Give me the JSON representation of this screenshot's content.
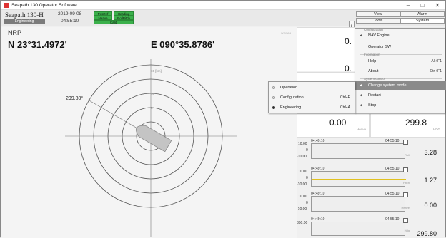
{
  "app": {
    "window_title": "Seapath 130 Operator Software",
    "product_name": "Seapath 130-H",
    "mode": "Engineering",
    "date": "2019-09-08",
    "time": "04:55:10"
  },
  "status_flags": [
    "PosRef",
    "Heading",
    "Heave",
    "RollPitch",
    "Calib"
  ],
  "top_buttons": {
    "view": "View",
    "alarm": "Alarm",
    "tools": "Tools",
    "system": "System"
  },
  "main": {
    "title": "NRP",
    "latitude": "N 23°31.4972'",
    "longitude": "E 090°35.8786'",
    "heading_mark": "299.80°",
    "ring_labels": [
      "15 [km]",
      "10",
      "5"
    ],
    "sensor_code": "WGS84"
  },
  "tiles": {
    "row1_value": "0.",
    "row2_value": "0.",
    "heave_value": "0.00",
    "heave_unit": "Heave",
    "hdg_value": "299.8",
    "hdg_unit": "HDG"
  },
  "menu": {
    "section_configuration": "Configuration",
    "nav_engine": "NAV Engine",
    "operator_sw": "Operator SW",
    "section_information": "Information",
    "help": "Help",
    "help_shortcut": "Alt+F1",
    "about": "About",
    "about_shortcut": "Ctrl+F1",
    "section_system_control": "System control",
    "change_system_mode": "Change system mode",
    "restart": "Restart",
    "stop": "Stop"
  },
  "submenu": {
    "operation": "Operation",
    "configuration": "Configuration",
    "configuration_shortcut": "Ctrl+E",
    "engineering": "Engineering",
    "engineering_shortcut": "Ctrl+A"
  },
  "trends": [
    {
      "start": "04:49:10",
      "end": "04:55:10",
      "ymax": "10.00",
      "ymid": "0",
      "ymin": "-10.00",
      "value": "3.28",
      "unit": "Roll",
      "color": "#3bb04b"
    },
    {
      "start": "04:49:10",
      "end": "04:55:10",
      "ymax": "10.00",
      "ymid": "0",
      "ymin": "-10.00",
      "value": "1.27",
      "unit": "Pitch",
      "color": "#e0c020"
    },
    {
      "start": "04:49:10",
      "end": "04:55:10",
      "ymax": "10.00",
      "ymid": "0",
      "ymin": "-10.00",
      "value": "0.00",
      "unit": "Heave",
      "color": "#3bb04b"
    },
    {
      "start": "04:49:10",
      "end": "04:55:10",
      "ymax": "360.00",
      "ymid": "",
      "ymin": "",
      "value": "299.80",
      "unit": "Hdg",
      "color": "#e0c020"
    }
  ]
}
